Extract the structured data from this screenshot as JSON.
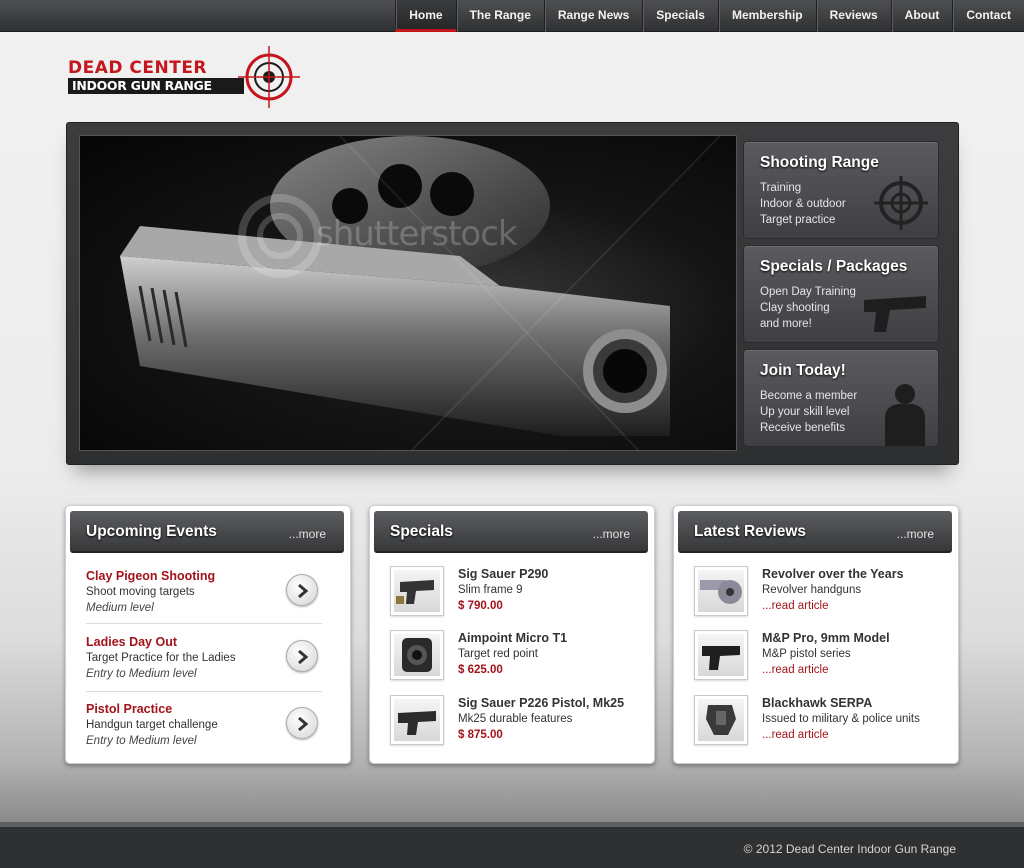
{
  "nav": {
    "items": [
      "Home",
      "The Range",
      "Range News",
      "Specials",
      "Membership",
      "Reviews",
      "About",
      "Contact"
    ],
    "active": "Home"
  },
  "logo": {
    "line1": "DEAD CENTER",
    "line2": "INDOOR GUN RANGE"
  },
  "hero": {
    "watermark": "shutterstock",
    "panels": [
      {
        "title": "Shooting Range",
        "lines": [
          "Training",
          "Indoor & outdoor",
          "Target practice"
        ],
        "icon": "crosshair-icon"
      },
      {
        "title": "Specials / Packages",
        "lines": [
          "Open Day Training",
          "Clay shooting",
          "and more!"
        ],
        "icon": "pistol-icon"
      },
      {
        "title": "Join Today!",
        "lines": [
          "Become a member",
          "Up your skill level",
          "Receive benefits"
        ],
        "icon": "silhouette-target-icon"
      }
    ]
  },
  "events": {
    "title": "Upcoming Events",
    "more": "...more",
    "items": [
      {
        "title": "Clay Pigeon Shooting",
        "desc": "Shoot moving targets",
        "level": "Medium level"
      },
      {
        "title": "Ladies Day Out",
        "desc": "Target Practice for the Ladies",
        "level": "Entry to Medium level"
      },
      {
        "title": "Pistol Practice",
        "desc": "Handgun target challenge",
        "level": "Entry to Medium level"
      }
    ]
  },
  "specials": {
    "title": "Specials",
    "more": "...more",
    "items": [
      {
        "title": "Sig Sauer P290",
        "desc": "Slim frame 9",
        "price": "$ 790.00"
      },
      {
        "title": "Aimpoint Micro T1",
        "desc": "Target red point",
        "price": "$ 625.00"
      },
      {
        "title": "Sig Sauer P226 Pistol, Mk25",
        "desc": "Mk25 durable features",
        "price": "$ 875.00"
      }
    ]
  },
  "reviews": {
    "title": "Latest Reviews",
    "more": "...more",
    "items": [
      {
        "title": "Revolver over the Years",
        "desc": "Revolver handguns",
        "link": "...read article"
      },
      {
        "title": "M&P Pro, 9mm Model",
        "desc": "M&P pistol series",
        "link": "...read article"
      },
      {
        "title": "Blackhawk SERPA",
        "desc": "Issued to military & police units",
        "link": "...read article"
      }
    ]
  },
  "footer": {
    "copyright": "© 2012  Dead Center Indoor Gun Range"
  },
  "colors": {
    "accent": "#c4161c",
    "link": "#a3131a",
    "dark": "#2f3032"
  }
}
